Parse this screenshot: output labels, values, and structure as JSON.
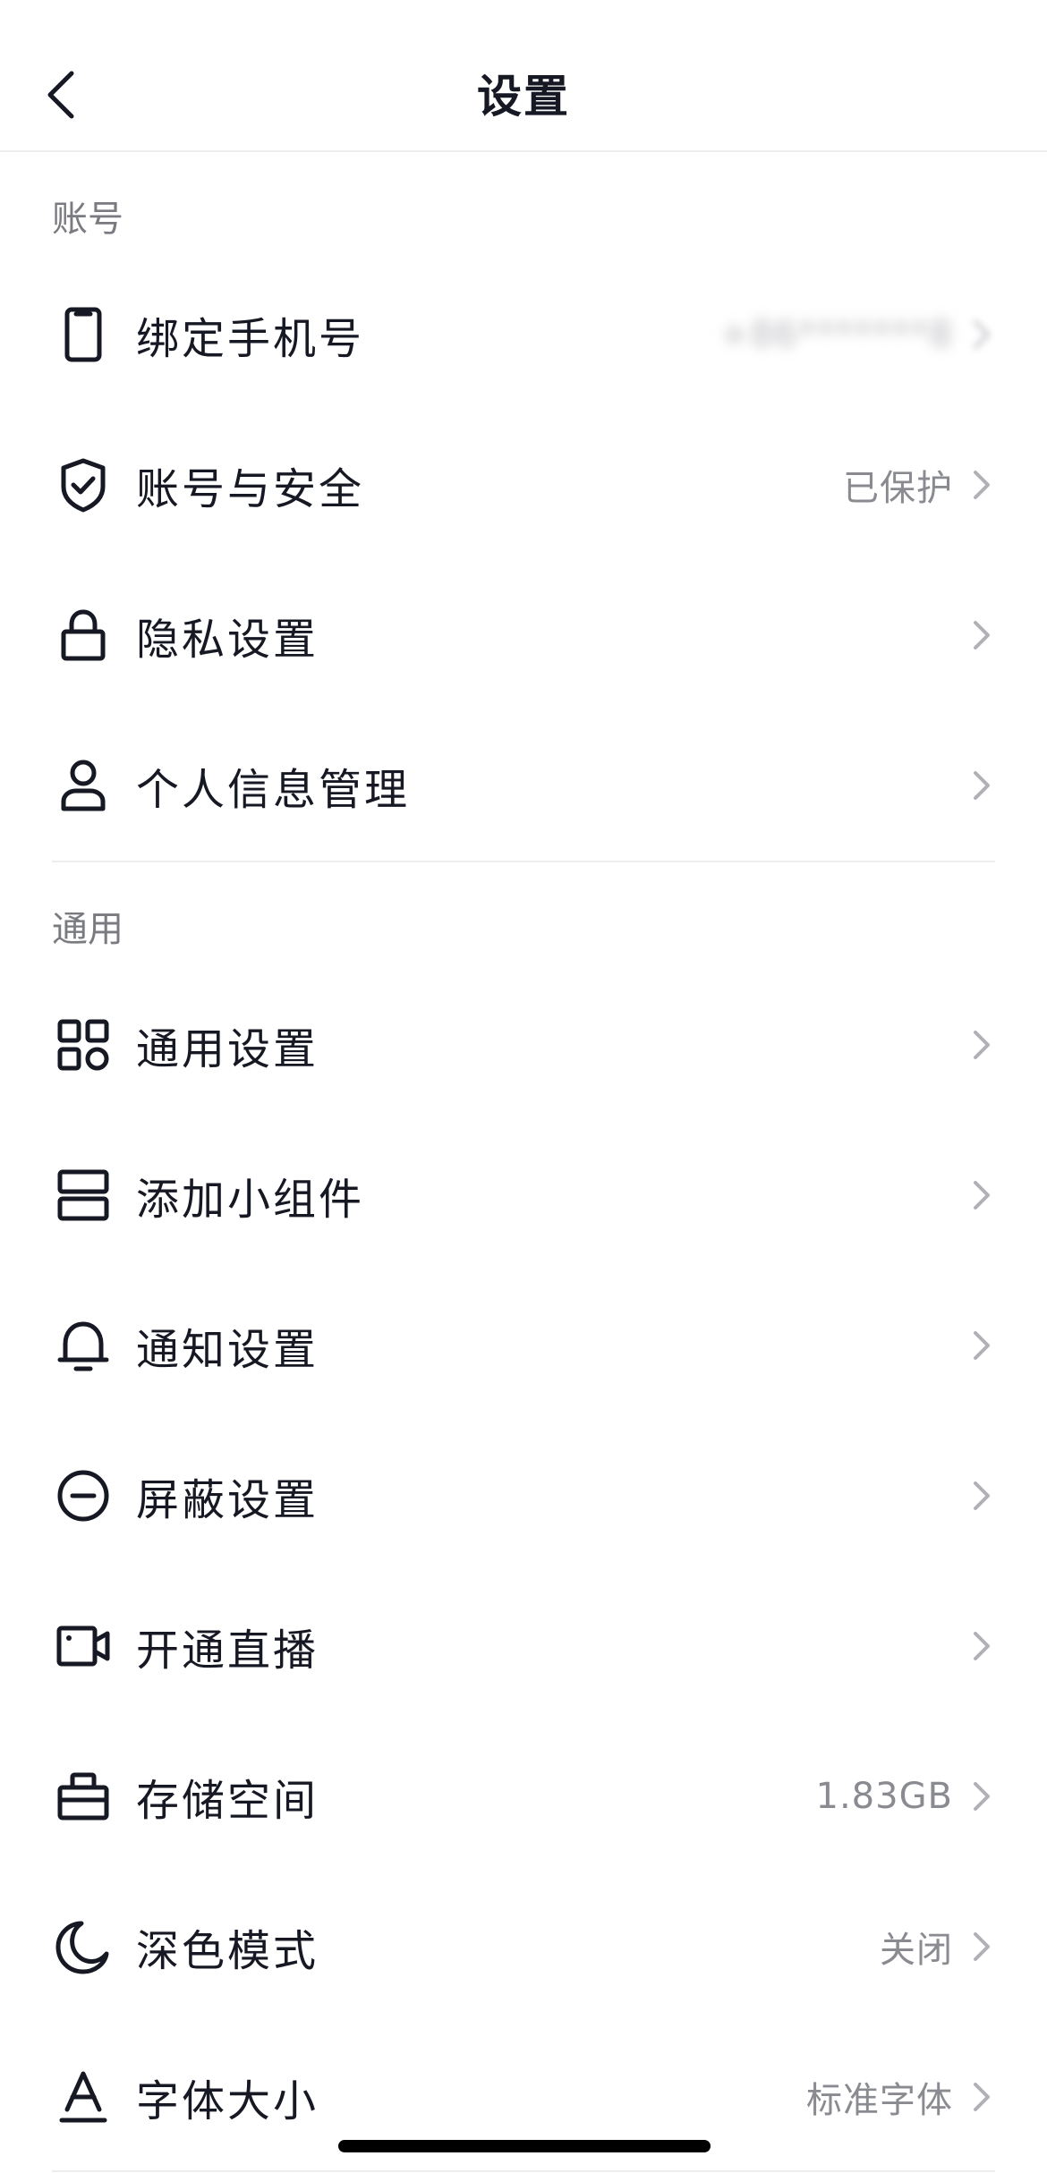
{
  "nav": {
    "title": "设置",
    "back_icon": "chevron-left-icon"
  },
  "sections": {
    "account": {
      "header": "账号"
    },
    "general": {
      "header": "通用"
    }
  },
  "rows": {
    "phone": {
      "label": "绑定手机号",
      "value": "+86*******8",
      "icon": "phone-icon"
    },
    "security": {
      "label": "账号与安全",
      "value": "已保护",
      "icon": "shield-check-icon"
    },
    "privacy": {
      "label": "隐私设置",
      "value": "",
      "icon": "lock-icon"
    },
    "personal_info": {
      "label": "个人信息管理",
      "value": "",
      "icon": "user-icon"
    },
    "general_settings": {
      "label": "通用设置",
      "value": "",
      "icon": "grid-icon"
    },
    "widget": {
      "label": "添加小组件",
      "value": "",
      "icon": "widget-icon"
    },
    "notification": {
      "label": "通知设置",
      "value": "",
      "icon": "bell-icon"
    },
    "block": {
      "label": "屏蔽设置",
      "value": "",
      "icon": "block-icon"
    },
    "live": {
      "label": "开通直播",
      "value": "",
      "icon": "video-camera-icon"
    },
    "storage": {
      "label": "存储空间",
      "value": "1.83GB",
      "icon": "storage-icon"
    },
    "dark_mode": {
      "label": "深色模式",
      "value": "关闭",
      "icon": "moon-icon"
    },
    "font_size": {
      "label": "字体大小",
      "value": "标准字体",
      "icon": "font-size-icon"
    }
  },
  "colors": {
    "text_primary": "#161823",
    "text_secondary": "#8a8b91",
    "divider": "#eeeeee",
    "background": "#ffffff"
  }
}
